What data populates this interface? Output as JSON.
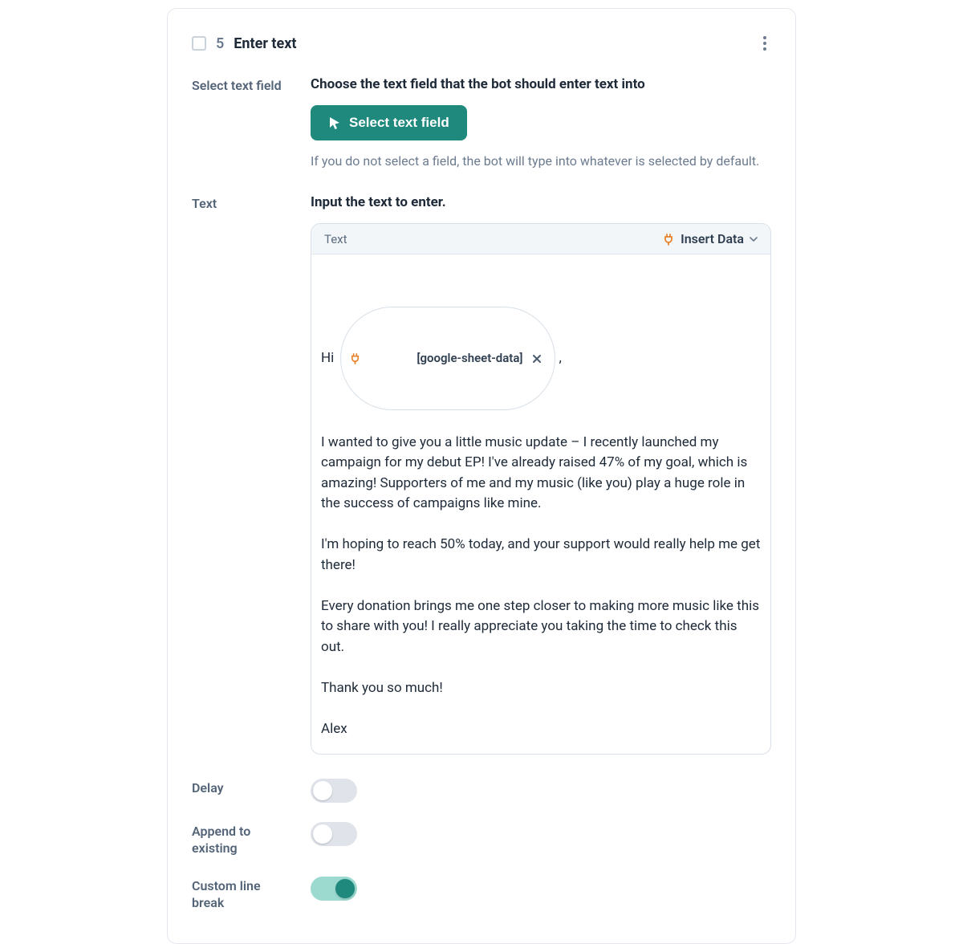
{
  "step": {
    "number": "5",
    "title": "Enter text"
  },
  "select_field": {
    "label": "Select text field",
    "heading": "Choose the text field that the bot should enter text into",
    "button": "Select text field",
    "helper": "If you do not select a field, the bot will type into whatever is selected by default."
  },
  "text_section": {
    "label": "Text",
    "heading": "Input the text to enter.",
    "bar_label": "Text",
    "insert_data_label": "Insert Data",
    "intro_prefix": "Hi ",
    "chip_label": "[google-sheet-data]",
    "intro_suffix": ",",
    "paragraphs": [
      "I wanted to give you a little music update – I recently launched my campaign for my debut EP! I've already raised 47% of my goal, which is amazing! Supporters of me and my music (like you) play a huge role in the success of campaigns like mine.",
      "I'm hoping to reach 50% today, and your support would really help me get there!",
      "Every donation brings me one step closer to making more music like this to share with you! I really appreciate you taking the time to check this out.",
      "Thank you so much!",
      "Alex"
    ]
  },
  "toggles": {
    "delay": {
      "label": "Delay",
      "value": false
    },
    "append": {
      "label": "Append to existing",
      "value": false
    },
    "custom_break": {
      "label": "Custom line break",
      "value": true
    }
  }
}
